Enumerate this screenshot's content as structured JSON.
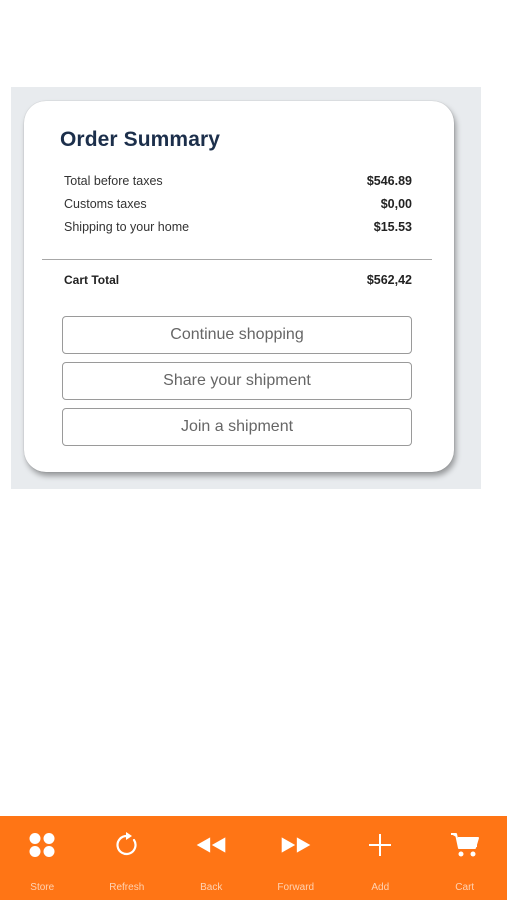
{
  "order_summary": {
    "title": "Order Summary",
    "rows": [
      {
        "label": "Total before taxes",
        "value": "$546.89"
      },
      {
        "label": "Customs taxes",
        "value": "$0,00"
      },
      {
        "label": "Shipping to your home",
        "value": "$15.53"
      }
    ],
    "total": {
      "label": "Cart Total",
      "value": "$562,42"
    },
    "buttons": {
      "continue": "Continue shopping",
      "share": "Share your shipment",
      "join": "Join a shipment"
    }
  },
  "bottom_nav": {
    "items": [
      {
        "label": "Store",
        "icon": "grid-icon"
      },
      {
        "label": "Refresh",
        "icon": "refresh-icon"
      },
      {
        "label": "Back",
        "icon": "rewind-icon"
      },
      {
        "label": "Forward",
        "icon": "fast-forward-icon"
      },
      {
        "label": "Add",
        "icon": "plus-icon"
      },
      {
        "label": "Cart",
        "icon": "cart-icon"
      }
    ]
  },
  "colors": {
    "accent": "#ff7515",
    "title": "#1c2f4b",
    "panel_bg": "#e8ebee"
  }
}
